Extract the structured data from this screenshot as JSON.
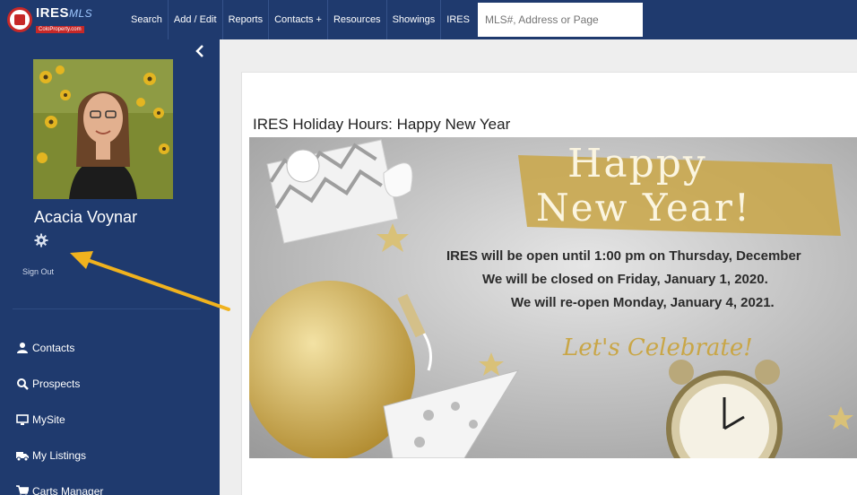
{
  "app": {
    "logo_text": "IRES",
    "logo_mls": "MLS",
    "logo_sub": "ColoProperty.com"
  },
  "nav": {
    "items": [
      {
        "label": "Search"
      },
      {
        "label": "Add / Edit"
      },
      {
        "label": "Reports"
      },
      {
        "label": "Contacts +"
      },
      {
        "label": "Resources"
      },
      {
        "label": "Showings"
      },
      {
        "label": "IRES"
      }
    ],
    "search_placeholder": "MLS#, Address or Page"
  },
  "sidebar": {
    "collapse_icon": "chevron-left-icon",
    "user_name": "Acacia Voynar",
    "settings_icon": "gear-icon",
    "sign_out": "Sign Out",
    "menu": [
      {
        "label": "Contacts",
        "icon": "user-icon"
      },
      {
        "label": "Prospects",
        "icon": "search-icon"
      },
      {
        "label": "MySite",
        "icon": "monitor-icon"
      },
      {
        "label": "My Listings",
        "icon": "truck-icon"
      },
      {
        "label": "Carts Manager",
        "icon": "cart-icon"
      }
    ]
  },
  "main": {
    "post_title": "IRES Holiday Hours: Happy New Year",
    "banner": {
      "headline_1": "Happy",
      "headline_2": "New Year!",
      "line_1": "IRES will be open until 1:00 pm on Thursday, December",
      "line_2": "We will be closed on Friday, January 1, 2020.",
      "line_3": "We will re-open Monday, January 4, 2021.",
      "tagline": "Let's Celebrate!"
    }
  },
  "colors": {
    "nav_bg": "#1f3a6e",
    "gold": "#c9a646",
    "annotation_arrow": "#f0b21e"
  }
}
